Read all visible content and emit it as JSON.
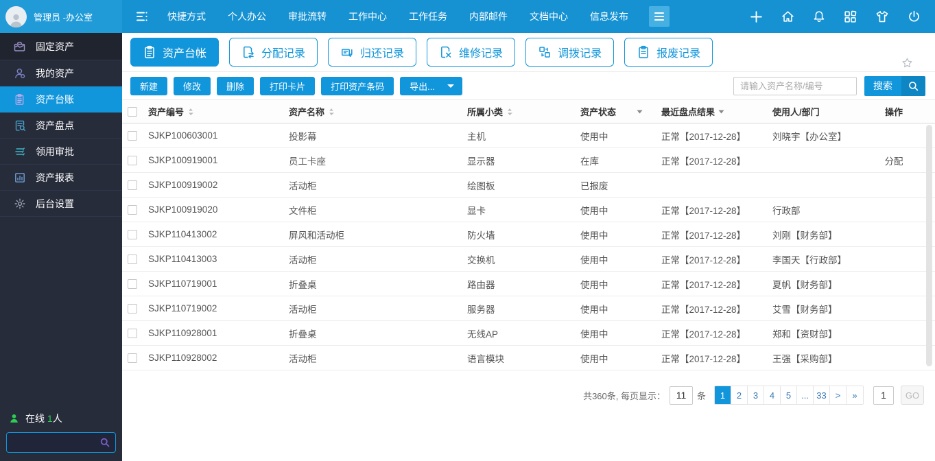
{
  "topbar": {
    "user_name": "管理员 -办公室",
    "nav_items": [
      "快捷方式",
      "个人办公",
      "审批流转",
      "工作中心",
      "工作任务",
      "内部邮件",
      "文档中心",
      "信息发布"
    ]
  },
  "sidebar": {
    "items": [
      {
        "label": "固定资产",
        "icon": "briefcase-icon"
      },
      {
        "label": "我的资产",
        "icon": "user-icon"
      },
      {
        "label": "资产台账",
        "icon": "ledger-icon"
      },
      {
        "label": "资产盘点",
        "icon": "inventory-check-icon"
      },
      {
        "label": "领用审批",
        "icon": "approval-icon"
      },
      {
        "label": "资产报表",
        "icon": "report-icon"
      },
      {
        "label": "后台设置",
        "icon": "settings-icon"
      }
    ],
    "online_label": "在线",
    "online_count": "1",
    "online_suffix": "人"
  },
  "tabs": [
    {
      "label": "资产台帐",
      "active": true
    },
    {
      "label": "分配记录",
      "active": false
    },
    {
      "label": "归还记录",
      "active": false
    },
    {
      "label": "维修记录",
      "active": false
    },
    {
      "label": "调拨记录",
      "active": false
    },
    {
      "label": "报废记录",
      "active": false
    }
  ],
  "toolbar": {
    "new": "新建",
    "edit": "修改",
    "delete": "删除",
    "print_card": "打印卡片",
    "print_barcode": "打印资产条码",
    "export": "导出...",
    "search_placeholder": "请输入资产名称/编号",
    "search": "搜索"
  },
  "table": {
    "headers": {
      "code": "资产编号",
      "name": "资产名称",
      "category": "所属小类",
      "status": "资产状态",
      "check": "最近盘点结果",
      "user": "使用人/部门",
      "action": "操作"
    },
    "rows": [
      {
        "code": "SJKP100603001",
        "name": "投影幕",
        "category": "主机",
        "status": "使用中",
        "check": "正常【2017-12-28】",
        "user": "刘晓宇【办公室】",
        "action": ""
      },
      {
        "code": "SJKP100919001",
        "name": "员工卡座",
        "category": "显示器",
        "status": "在库",
        "check": "正常【2017-12-28】",
        "user": "",
        "action": "分配"
      },
      {
        "code": "SJKP100919002",
        "name": "活动柜",
        "category": "绘图板",
        "status": "已报废",
        "check": "",
        "user": "",
        "action": ""
      },
      {
        "code": "SJKP100919020",
        "name": "文件柜",
        "category": "显卡",
        "status": "使用中",
        "check": "正常【2017-12-28】",
        "user": "行政部",
        "action": ""
      },
      {
        "code": "SJKP110413002",
        "name": "屏风和活动柜",
        "category": "防火墙",
        "status": "使用中",
        "check": "正常【2017-12-28】",
        "user": "刘刚【财务部】",
        "action": ""
      },
      {
        "code": "SJKP110413003",
        "name": "活动柜",
        "category": "交换机",
        "status": "使用中",
        "check": "正常【2017-12-28】",
        "user": "李国天【行政部】",
        "action": ""
      },
      {
        "code": "SJKP110719001",
        "name": "折叠桌",
        "category": "路由器",
        "status": "使用中",
        "check": "正常【2017-12-28】",
        "user": "夏帆【财务部】",
        "action": ""
      },
      {
        "code": "SJKP110719002",
        "name": "活动柜",
        "category": "服务器",
        "status": "使用中",
        "check": "正常【2017-12-28】",
        "user": "艾雪【财务部】",
        "action": ""
      },
      {
        "code": "SJKP110928001",
        "name": "折叠桌",
        "category": "无线AP",
        "status": "使用中",
        "check": "正常【2017-12-28】",
        "user": "郑和【资财部】",
        "action": ""
      },
      {
        "code": "SJKP110928002",
        "name": "活动柜",
        "category": "语言模块",
        "status": "使用中",
        "check": "正常【2017-12-28】",
        "user": "王强【采购部】",
        "action": ""
      }
    ]
  },
  "pagination": {
    "summary": "共360条, 每页显示：",
    "page_size": "11",
    "unit": "条",
    "pages": [
      {
        "label": "1",
        "active": true
      },
      {
        "label": "2"
      },
      {
        "label": "3"
      },
      {
        "label": "4"
      },
      {
        "label": "5"
      },
      {
        "label": "..."
      },
      {
        "label": "33"
      },
      {
        "label": ">"
      },
      {
        "label": "»"
      }
    ],
    "goto_value": "1",
    "go": "GO"
  },
  "colors": {
    "primary": "#1296db",
    "topbar": "#1692d3",
    "sidebar": "#272c3b",
    "online_green": "#2ecc52"
  }
}
